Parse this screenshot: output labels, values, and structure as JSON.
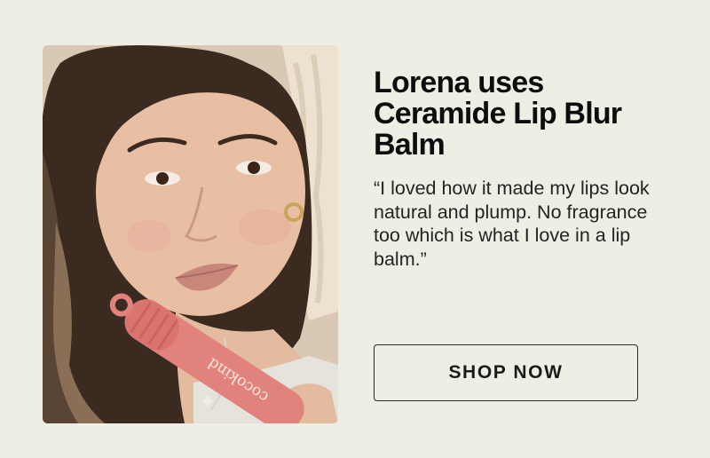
{
  "headline": "Lorena uses Ceramide Lip Blur Balm",
  "quote": "“I loved how it made my lips look natural and plump. No fragrance too which is what I love in a lip balm.”",
  "cta_label": "SHOP NOW",
  "product_brand": "cocokind",
  "colors": {
    "background": "#efeee4",
    "text": "#111111",
    "button_border": "#2a2a2a",
    "tube": "#e2827c"
  }
}
